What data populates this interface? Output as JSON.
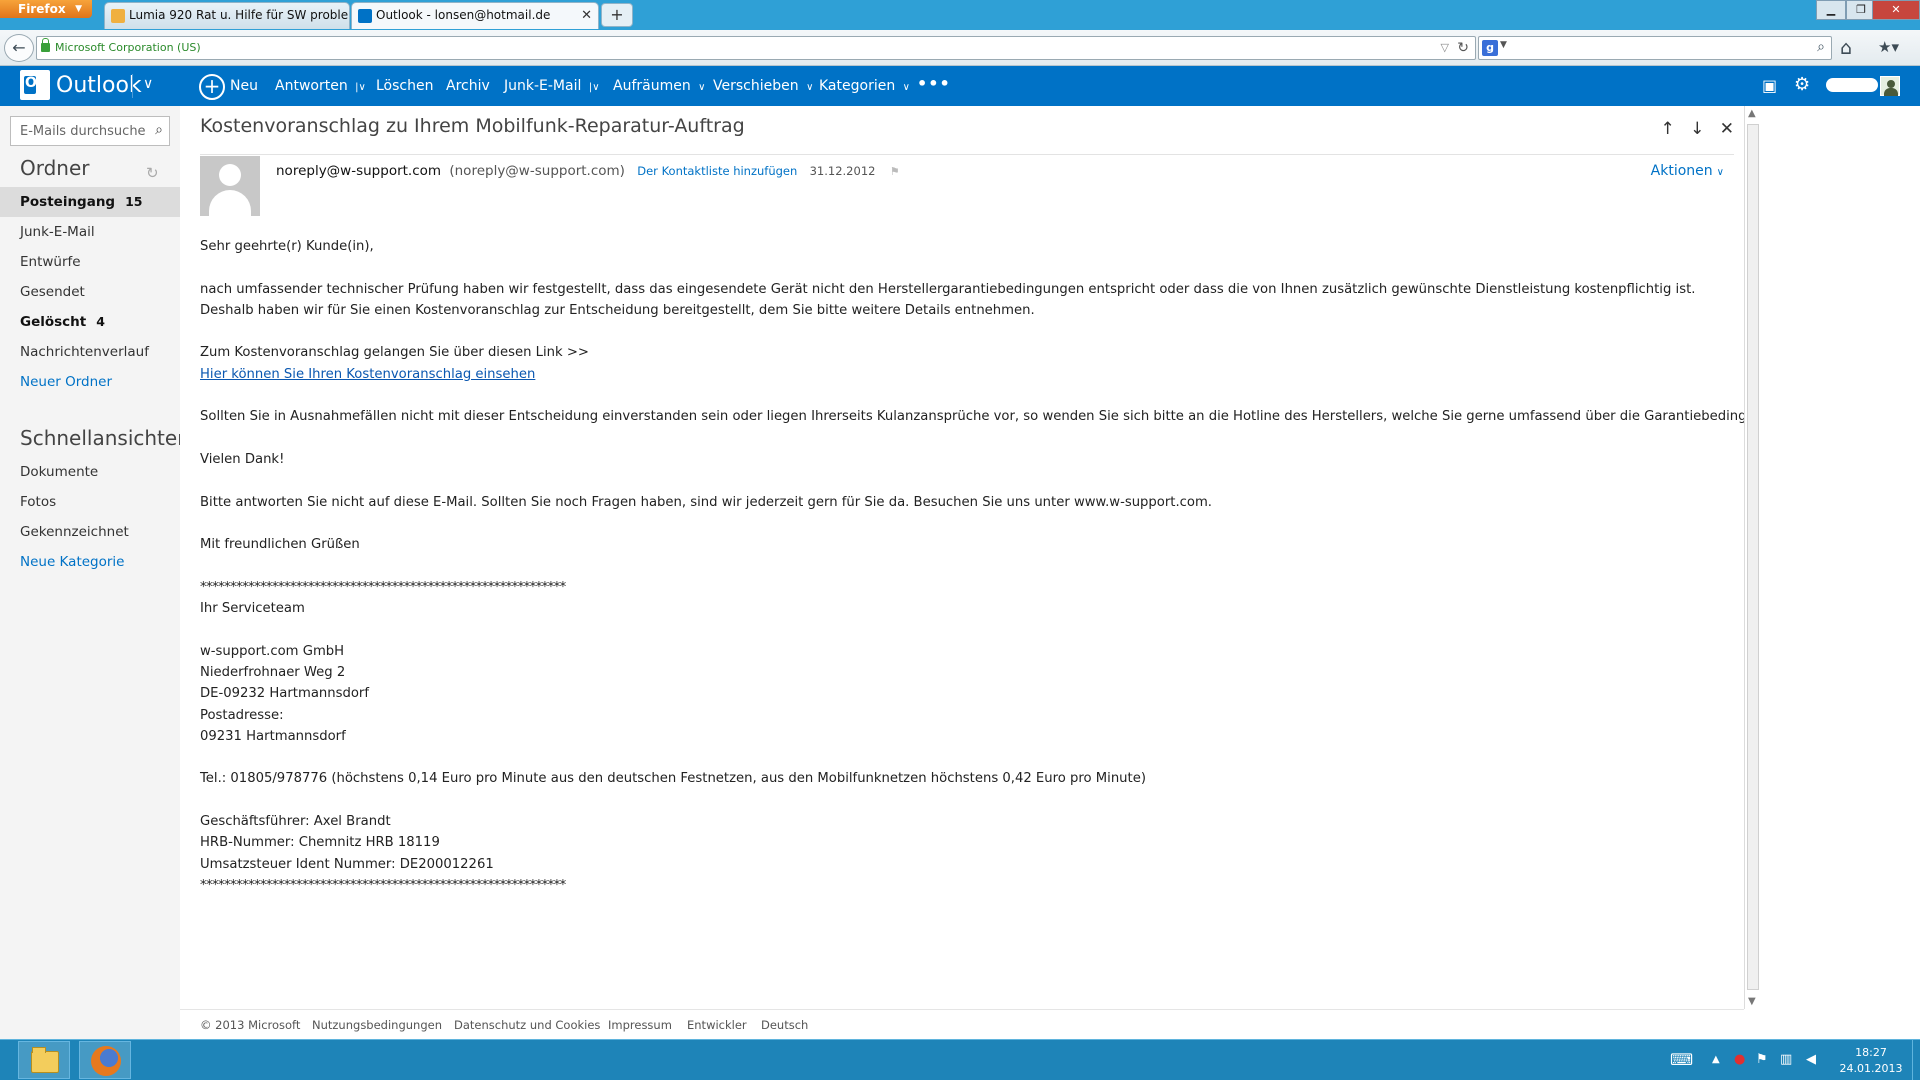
{
  "browser": {
    "menu_label": "Firefox",
    "tabs": [
      {
        "label": "Lumia 920 Rat u. Hilfe für SW proble..."
      },
      {
        "label": "Outlook - lonsen@hotmail.de"
      }
    ],
    "identity": "Microsoft Corporation (US)"
  },
  "outlook": {
    "brand": "Outlook",
    "commands": {
      "new": "Neu",
      "reply": "Antworten",
      "delete": "Löschen",
      "archive": "Archiv",
      "junk": "Junk-E-Mail",
      "sweep": "Aufräumen",
      "move": "Verschieben",
      "categories": "Kategorien",
      "more": "•••"
    }
  },
  "sidebar": {
    "search_placeholder": "E-Mails durchsuchen",
    "folders_title": "Ordner",
    "folders": [
      {
        "label": "Posteingang",
        "count": "15"
      },
      {
        "label": "Junk-E-Mail",
        "count": ""
      },
      {
        "label": "Entwürfe",
        "count": ""
      },
      {
        "label": "Gesendet",
        "count": ""
      },
      {
        "label": "Gelöscht",
        "count": "4"
      },
      {
        "label": "Nachrichtenverlauf",
        "count": ""
      },
      {
        "label": "Neuer Ordner",
        "count": ""
      }
    ],
    "quick_title": "Schnellansichten",
    "quick": [
      {
        "label": "Dokumente"
      },
      {
        "label": "Fotos"
      },
      {
        "label": "Gekennzeichnet"
      },
      {
        "label": "Neue Kategorie"
      }
    ]
  },
  "message": {
    "subject": "Kostenvoranschlag zu Ihrem Mobilfunk-Reparatur-Auftrag",
    "sender_name": "noreply@w-support.com",
    "sender_addr": "(noreply@w-support.com)",
    "add_contact": "Der Kontaktliste hinzufügen",
    "date": "31.12.2012",
    "actions": "Aktionen",
    "body": {
      "greeting": "Sehr geehrte(r) Kunde(in),",
      "p1a": "nach umfassender technischer Prüfung haben wir festgestellt, dass das eingesendete Gerät nicht den Herstellergarantiebedingungen entspricht oder dass die von Ihnen zusätzlich gewünschte Dienstleistung kostenpflichtig ist.",
      "p1b": "Deshalb haben wir für Sie einen Kostenvoranschlag zur Entscheidung bereitgestellt, dem Sie bitte weitere Details entnehmen.",
      "p2a": "Zum Kostenvoranschlag gelangen Sie über diesen Link >>",
      "p2_link": "Hier können Sie Ihren Kostenvoranschlag einsehen",
      "p3": "Sollten Sie in Ausnahmefällen nicht mit dieser Entscheidung einverstanden sein oder liegen Ihrerseits Kulanzansprüche vor, so wenden Sie sich bitte an die Hotline des Herstellers, welche Sie gerne umfassend über die Garantiebedingungen informiert.",
      "thanks": "Vielen Dank!",
      "p4": "Bitte antworten Sie nicht auf diese E-Mail. Sollten Sie noch Fragen haben, sind wir jederzeit gern für Sie da. Besuchen Sie uns unter www.w-support.com.",
      "closing": "Mit freundlichen Grüßen",
      "stars": "*************************************************************",
      "team": "Ihr Serviceteam",
      "company": "w-support.com GmbH",
      "street": "Niederfrohnaer Weg 2",
      "city": "DE-09232 Hartmannsdorf",
      "postal_label": "Postadresse:",
      "postal_city": "09231 Hartmannsdorf",
      "phone": "Tel.: 01805/978776 (höchstens 0,14 Euro pro Minute aus den deutschen Festnetzen, aus den Mobilfunknetzen höchstens 0,42 Euro pro Minute)",
      "ceo": "Geschäftsführer: Axel Brandt",
      "hrb": "HRB-Nummer: Chemnitz HRB 18119",
      "vat": "Umsatzsteuer Ident Nummer: DE200012261"
    }
  },
  "footer": {
    "copyright": "© 2013 Microsoft",
    "terms": "Nutzungsbedingungen",
    "privacy": "Datenschutz und Cookies",
    "imprint": "Impressum",
    "developers": "Entwickler",
    "language": "Deutsch"
  },
  "taskbar": {
    "time": "18:27",
    "date": "24.01.2013"
  },
  "colors": {
    "outlook_blue": "#0072c6",
    "link_blue": "#0a57b0",
    "taskbar": "#1e84b8",
    "firefox_orange": "#e0741a"
  }
}
